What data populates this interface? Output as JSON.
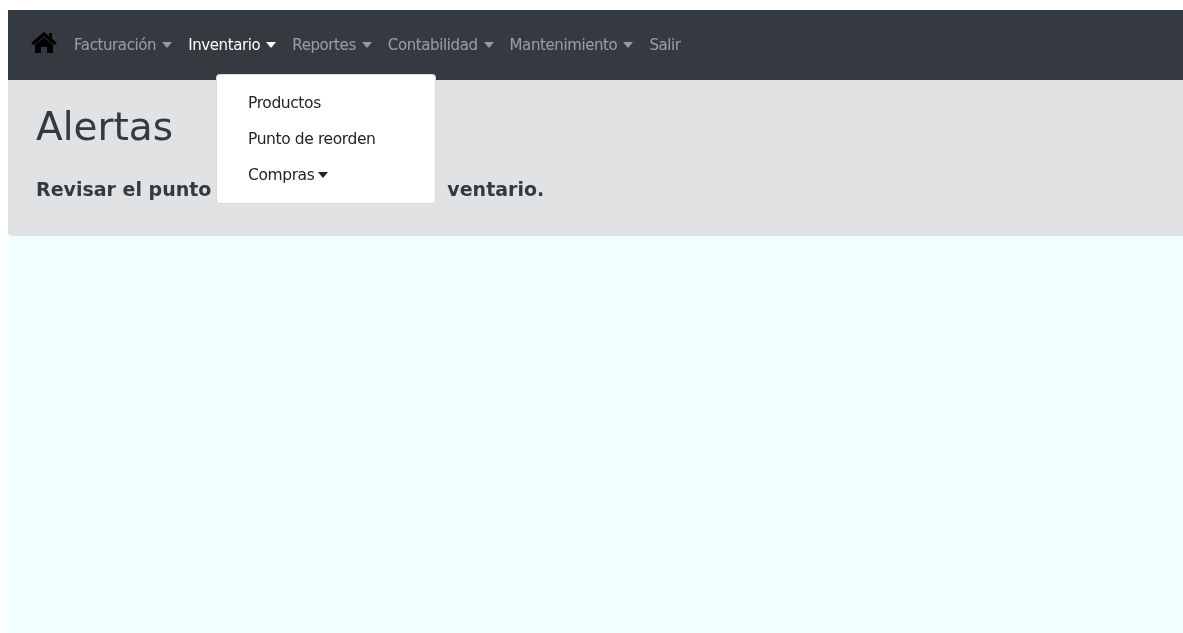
{
  "navbar": {
    "items": [
      {
        "label": "Facturación",
        "dropdown": true,
        "selected": false
      },
      {
        "label": "Inventario",
        "dropdown": true,
        "selected": true
      },
      {
        "label": "Reportes",
        "dropdown": true,
        "selected": false
      },
      {
        "label": "Contabilidad",
        "dropdown": true,
        "selected": false
      },
      {
        "label": "Mantenimiento",
        "dropdown": true,
        "selected": false
      },
      {
        "label": "Salir",
        "dropdown": false,
        "selected": false
      }
    ]
  },
  "dropdown_menu": {
    "items": [
      {
        "label": "Productos",
        "submenu": false
      },
      {
        "label": "Punto de reorden",
        "submenu": false
      },
      {
        "label": "Compras",
        "submenu": true
      }
    ]
  },
  "jumbotron": {
    "title": "Alertas",
    "lead_visible_start": "Revisar el punto",
    "lead_visible_end": "ventario."
  }
}
